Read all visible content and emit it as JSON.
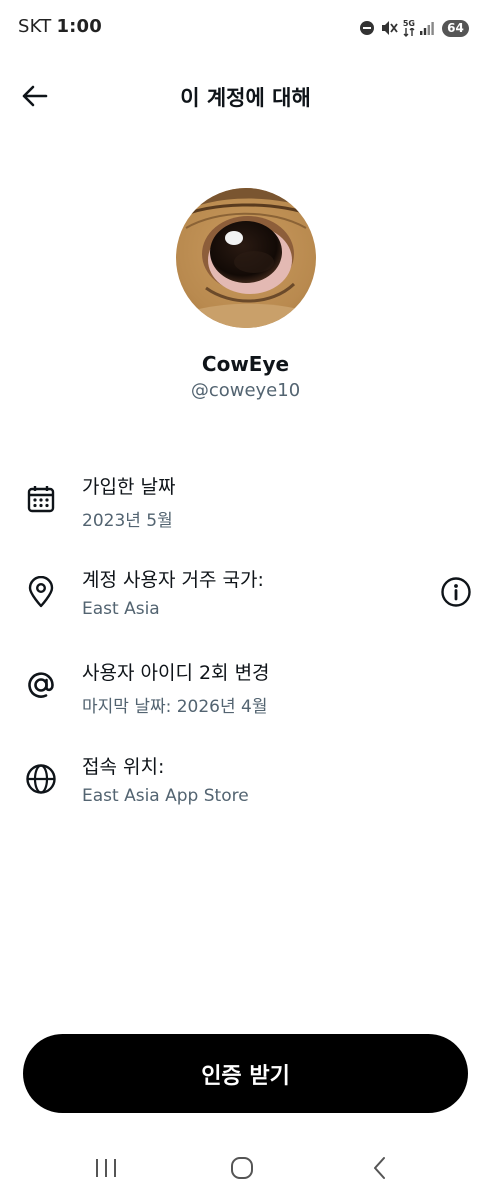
{
  "status_bar": {
    "carrier": "SKT",
    "time": "1:00",
    "network": "5G",
    "battery": "64"
  },
  "header": {
    "title": "이 계정에 대해"
  },
  "profile": {
    "display_name": "CowEye",
    "handle": "@coweye10"
  },
  "info": {
    "joined": {
      "label": "가입한 날짜",
      "value": "2023년 5월",
      "icon": "calendar-icon"
    },
    "country": {
      "label": "계정 사용자 거주 국가:",
      "value": "East Asia",
      "icon": "location-pin-icon"
    },
    "username_changes": {
      "label": "사용자 아이디 2회 변경",
      "value": "마지막 날짜: 2026년 4월",
      "icon": "at-sign-icon"
    },
    "connected_via": {
      "label": "접속 위치:",
      "value": "East Asia App Store",
      "icon": "globe-icon"
    }
  },
  "actions": {
    "verify_label": "인증 받기"
  },
  "colors": {
    "text_primary": "#0f1419",
    "text_secondary": "#536471",
    "button_bg": "#000000",
    "button_text": "#ffffff"
  }
}
